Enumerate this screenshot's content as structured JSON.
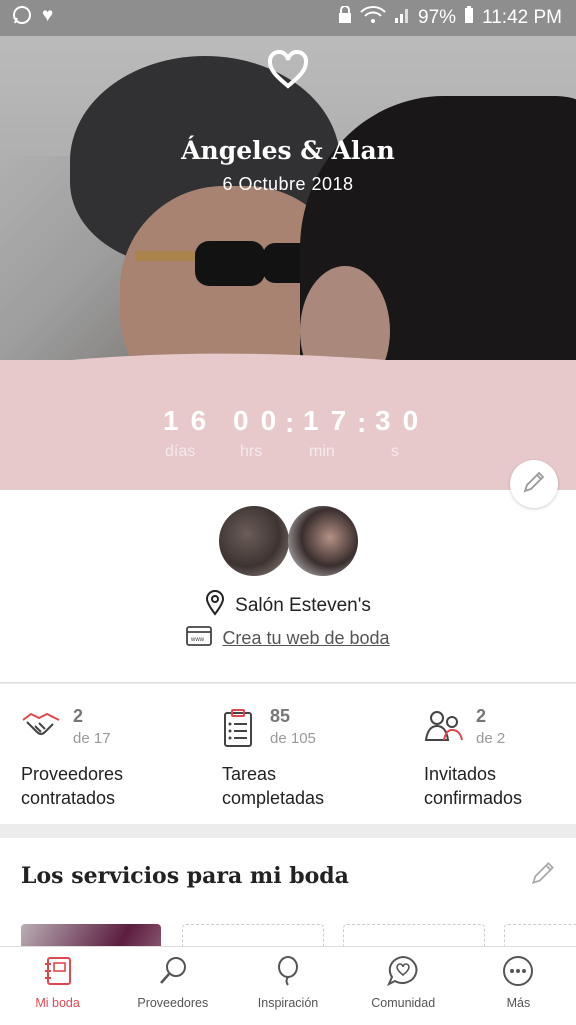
{
  "status_bar": {
    "battery": "97%",
    "time": "11:42 PM"
  },
  "hero": {
    "couple_name": "Ángeles & Alan",
    "date": "6 Octubre 2018"
  },
  "countdown": {
    "days": "16",
    "hours": "00",
    "minutes": "17",
    "seconds": "30",
    "days_label": "días",
    "hours_label": "hrs",
    "minutes_label": "min",
    "seconds_label": "s"
  },
  "profile": {
    "venue": "Salón Esteven's",
    "web_link": "Crea tu web de boda"
  },
  "stats": [
    {
      "value": "2",
      "of": "de 17",
      "line1": "Proveedores",
      "line2": "contratados",
      "icon": "handshake-icon"
    },
    {
      "value": "85",
      "of": "de 105",
      "line1": "Tareas",
      "line2": "completadas",
      "icon": "clipboard-icon"
    },
    {
      "value": "2",
      "of": "de 2",
      "line1": "Invitados",
      "line2": "confirmados",
      "icon": "guests-icon"
    }
  ],
  "services": {
    "heading": "Los servicios para mi boda"
  },
  "nav": [
    {
      "label": "Mi boda",
      "icon": "notebook-icon",
      "active": true
    },
    {
      "label": "Proveedores",
      "icon": "search-icon",
      "active": false
    },
    {
      "label": "Inspiración",
      "icon": "balloon-icon",
      "active": false
    },
    {
      "label": "Comunidad",
      "icon": "chat-heart-icon",
      "active": false
    },
    {
      "label": "Más",
      "icon": "more-icon",
      "active": false
    }
  ],
  "colors": {
    "accent": "#e0484f",
    "pink_band": "#e7c9cb"
  }
}
